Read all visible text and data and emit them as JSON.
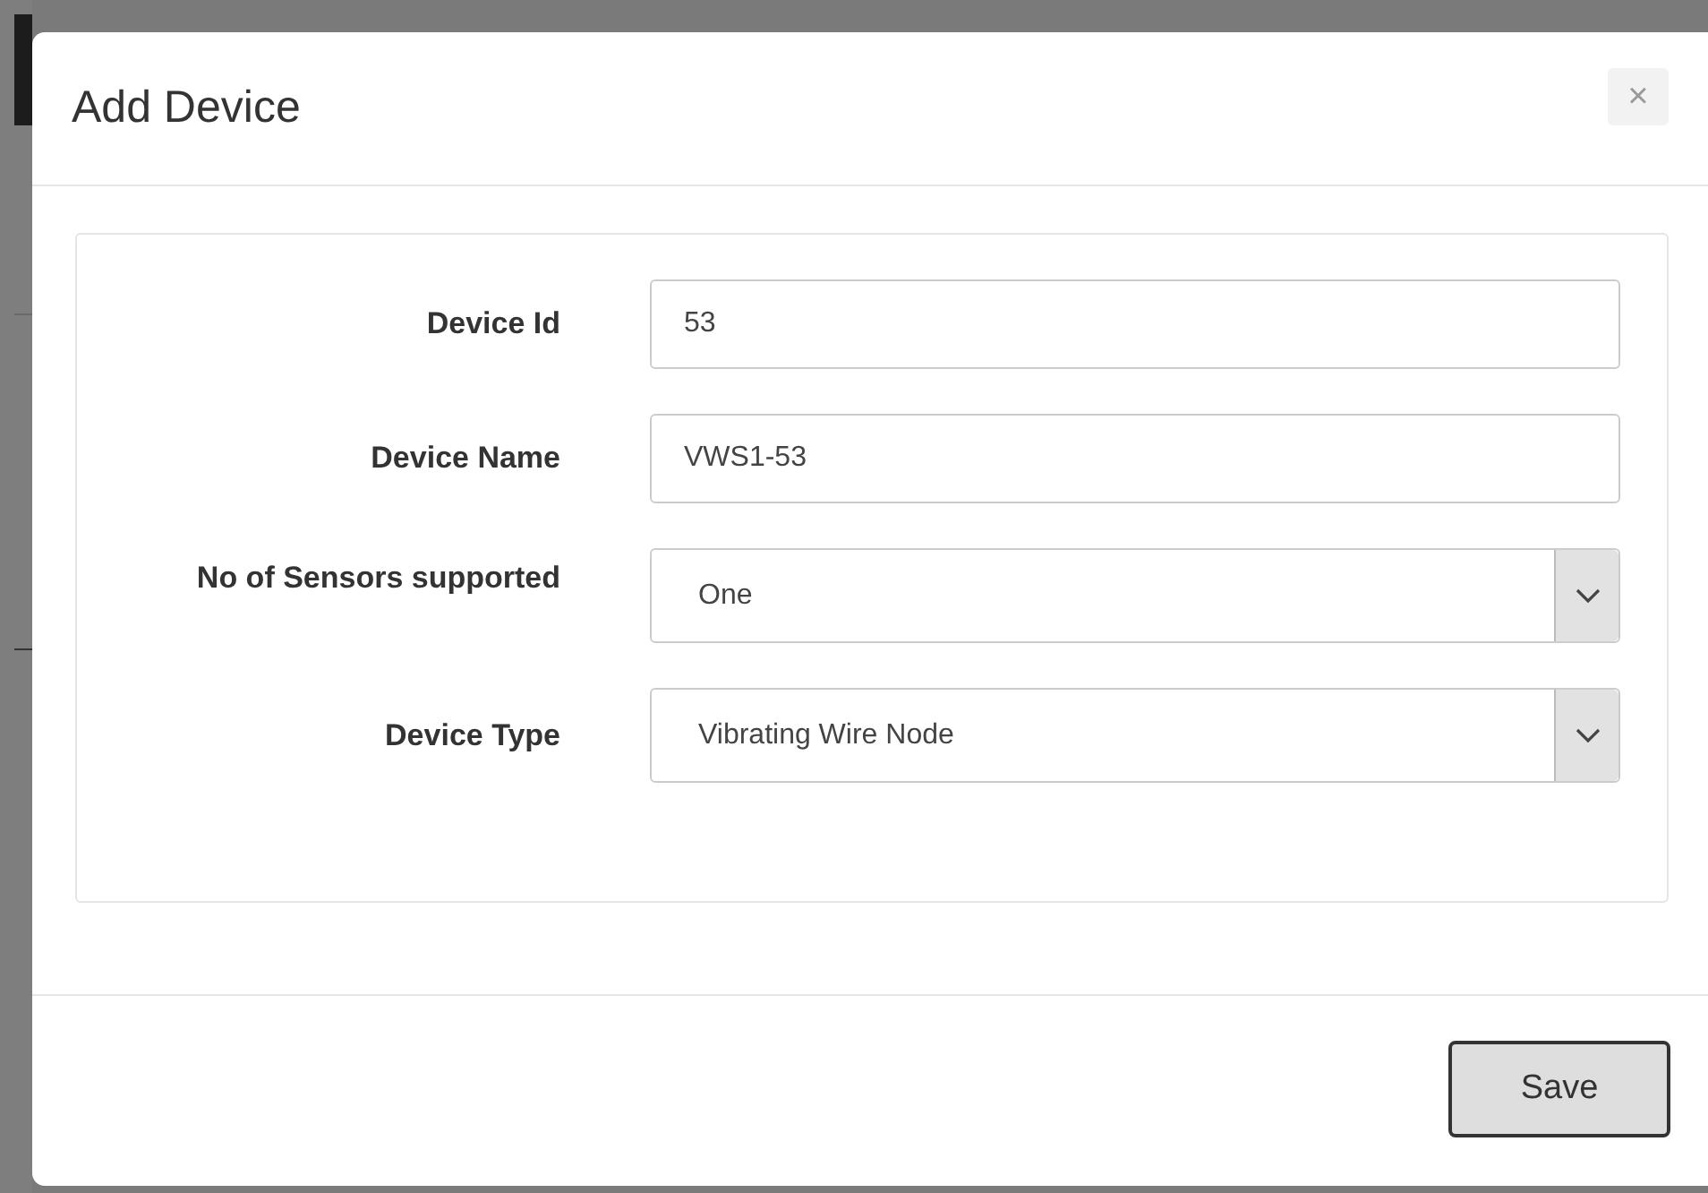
{
  "dialog": {
    "title": "Add Device",
    "close_label": "×",
    "fields": [
      {
        "kind": "text",
        "label": "Device Id",
        "value": "53"
      },
      {
        "kind": "text",
        "label": "Device Name",
        "value": "VWS1-53"
      },
      {
        "kind": "select",
        "label": "No of Sensors supported",
        "value": "One"
      },
      {
        "kind": "select",
        "label": "Device Type",
        "value": "Vibrating Wire Node"
      }
    ],
    "buttons": [
      "Save"
    ]
  }
}
